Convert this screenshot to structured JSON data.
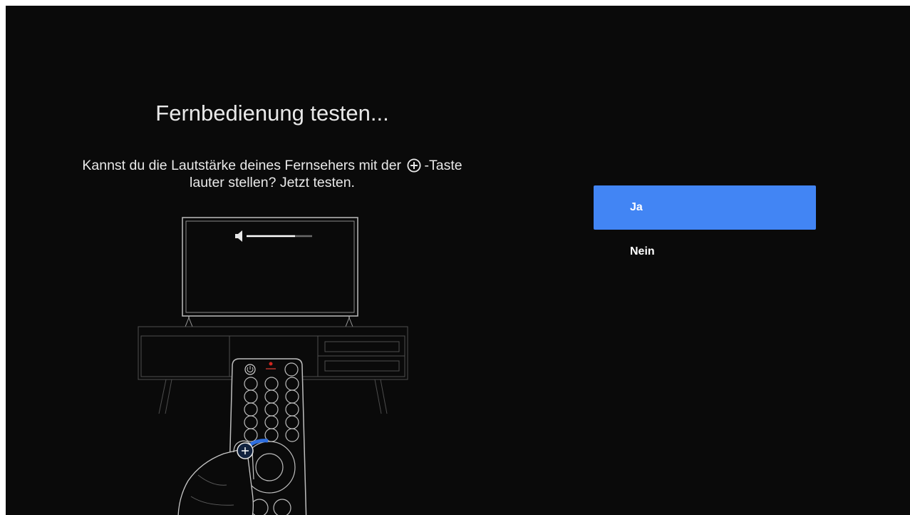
{
  "dialog": {
    "title": "Fernbedienung testen...",
    "question_part1": "Kannst du die Lautstärke deines Fernsehers mit der",
    "question_part2": "-Taste",
    "question_line2": "lauter stellen? Jetzt testen."
  },
  "options": [
    {
      "label": "Ja",
      "selected": true
    },
    {
      "label": "Nein",
      "selected": false
    }
  ],
  "illustration": {
    "icons": [
      "tv-icon",
      "volume-icon",
      "remote-icon",
      "hand-icon",
      "plus-circle-icon"
    ]
  },
  "colors": {
    "background": "#0a0a0a",
    "accent": "#4285f4",
    "text": "#e9e9e9"
  }
}
